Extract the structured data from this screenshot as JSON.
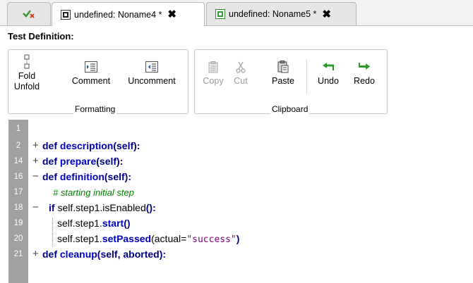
{
  "tabs": [
    {
      "label": "",
      "icon": "check-x-icon"
    },
    {
      "label": "undefined: Noname4 *",
      "icon": "document-icon",
      "active": true
    },
    {
      "label": "undefined: Noname5 *",
      "icon": "spreadsheet-icon"
    }
  ],
  "toolbar": {
    "title": "Test Definition:",
    "formatting_label": "Formatting",
    "clipboard_label": "Clipboard",
    "fold": "Fold",
    "unfold": "Unfold",
    "comment": "Comment",
    "uncomment": "Uncomment",
    "copy": "Copy",
    "cut": "Cut",
    "paste": "Paste",
    "undo": "Undo",
    "redo": "Redo"
  },
  "editor": {
    "lines": [
      {
        "num": "1",
        "fold": ""
      },
      {
        "num": "2",
        "fold": "+",
        "def": "def",
        "name": "description",
        "args": "(self):"
      },
      {
        "num": "14",
        "fold": "+",
        "def": "def",
        "name": "prepare",
        "args": "(self):"
      },
      {
        "num": "16",
        "fold": "−",
        "def": "def",
        "name": "definition",
        "args": "(self):"
      },
      {
        "num": "17",
        "fold": "",
        "comment": "# starting initial step"
      },
      {
        "num": "18",
        "fold": "−",
        "kw": "if",
        "pre": " self.step1.isEnabled",
        "paren": "():"
      },
      {
        "num": "19",
        "fold": "",
        "pre": "self.step1.",
        "method": "start",
        "paren": "()"
      },
      {
        "num": "20",
        "fold": "",
        "pre": "self.step1.",
        "method": "setPassed",
        "arg": "(actual=",
        "str": "\"success\"",
        "close": ")"
      },
      {
        "num": "21",
        "fold": "+",
        "def": "def",
        "name": "cleanup",
        "args": "(self, aborted):"
      }
    ]
  },
  "colors": {
    "gutter": "#a0a0a0",
    "keyword": "#000080",
    "function": "#0000c0",
    "comment": "#008000",
    "string": "#800080",
    "undo": "#2e9a2e"
  }
}
